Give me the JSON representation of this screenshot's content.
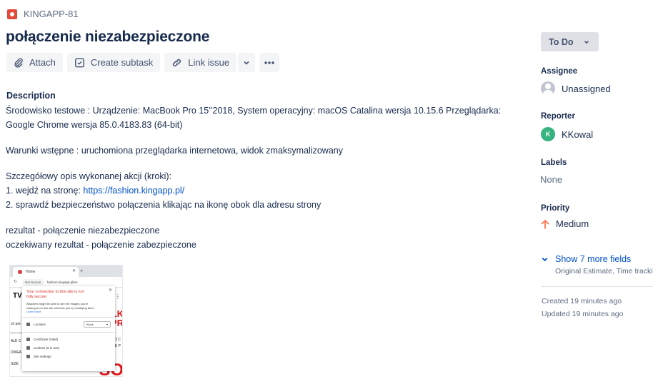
{
  "issue": {
    "key": "KINGAPP-81",
    "summary": "połączenie niezabezpieczone"
  },
  "toolbar": {
    "attach": "Attach",
    "create_subtask": "Create subtask",
    "link_issue": "Link issue"
  },
  "description": {
    "title": "Description",
    "line1": "Środowisko testowe : Urządzenie: MacBook Pro 15’’2018, System operacyjny: macOS Catalina wersja 10.15.6 Przeglądarka: Google Chrome wersja 85.0.4183.83 (64-bit)",
    "line2": "Warunki wstępne : uruchomiona przeglądarka internetowa, widok zmaksymalizowany",
    "line3": "Szczegółowy opis wykonanej akcji (kroki):",
    "step1_prefix": "1. wejdź na stronę: ",
    "step1_link": "https://fashion.kingapp.pl/",
    "step2": "2. sprawdź bezpieczeństwo połączenia klikając na ikonę obok dla adresu strony",
    "result": "rezultat - połączenie niezabezpieczone",
    "expected": "oczekiwany rezultat - połączenie zabezpieczone"
  },
  "attachment": {
    "tab": "Home",
    "not_secure": "Not Secure",
    "url": "fashion.kingapp.pl/en",
    "warn": "Your connection to this site is not fully secure",
    "text": "Attackers might be able to see the images you're looking at on this site and trick you by modifying them.",
    "learn_more": "Learn more",
    "location": "Location",
    "block": "Block",
    "certificate": "Certificate (Valid)",
    "cookies": "Cookies (6 in use)",
    "site_settings": "Site settings",
    "tv": "TV",
    "red1": "ELK",
    "red2": "YPR",
    "big": "SO",
    "small1": "ALE C",
    "small2": "DWEA",
    "small3": "SIZE",
    "small4": "ch pre",
    "small5": "O DO C",
    "small6": "ANE P"
  },
  "sidebar": {
    "status": "To Do",
    "assignee_label": "Assignee",
    "assignee_value": "Unassigned",
    "reporter_label": "Reporter",
    "reporter_initial": "K",
    "reporter_value": "KKowal",
    "labels_label": "Labels",
    "labels_value": "None",
    "priority_label": "Priority",
    "priority_value": "Medium",
    "show_more": "Show 7 more fields",
    "show_more_sub": "Original Estimate, Time tracking",
    "created": "Created 19 minutes ago",
    "updated": "Updated 19 minutes ago"
  },
  "colors": {
    "accent": "#0052cc",
    "priority_medium": "#ff7452",
    "reporter_avatar": "#36b37e",
    "issue_type": "#e5493a"
  }
}
